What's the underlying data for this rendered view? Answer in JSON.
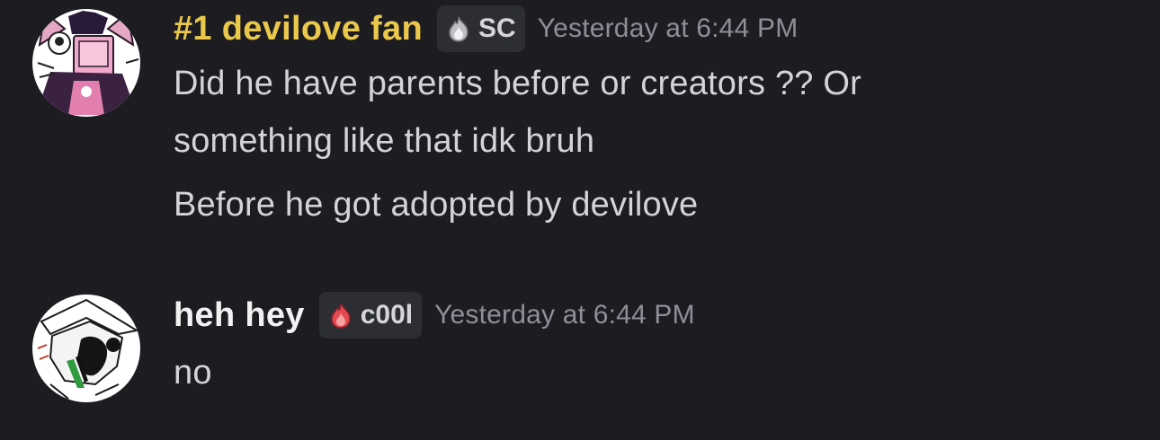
{
  "messages": [
    {
      "author": "#1 devilove fan",
      "author_color": "#eac84b",
      "tag": {
        "icon": "silver-flame-icon",
        "text": "SC"
      },
      "timestamp": "Yesterday at 6:44 PM",
      "lines": [
        "Did he have parents before or creators ?? Or",
        "something like that idk bruh"
      ],
      "followup": "Before he got adopted by devilove"
    },
    {
      "author": "heh hey",
      "author_color": "#f2f2f3",
      "tag": {
        "icon": "red-flame-icon",
        "text": "c00l"
      },
      "timestamp": "Yesterday at 6:44 PM",
      "lines": [
        "no"
      ]
    }
  ]
}
